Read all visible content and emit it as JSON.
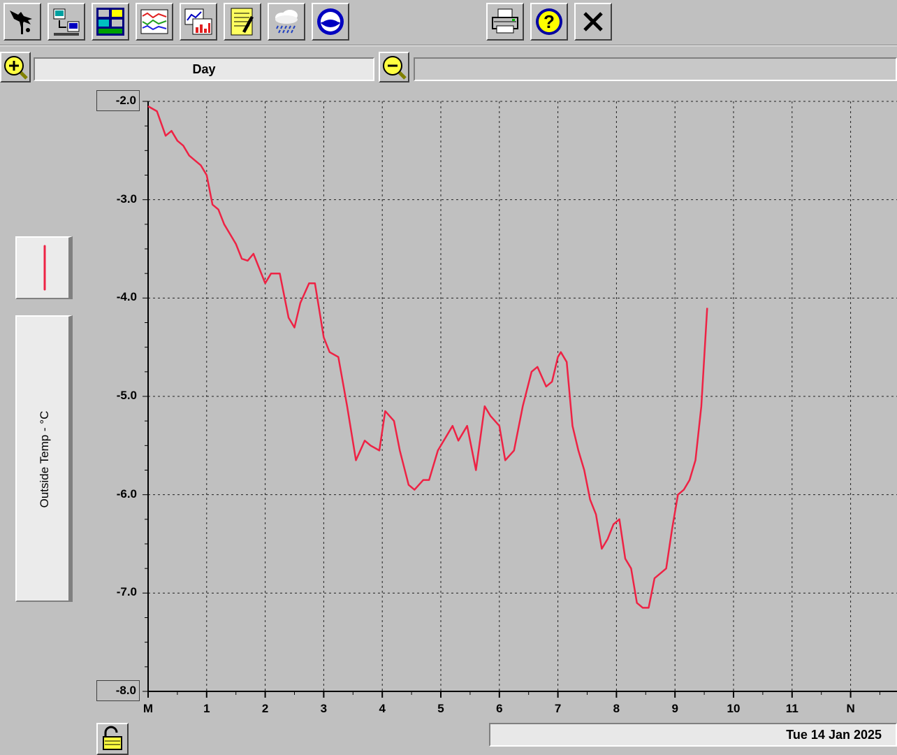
{
  "toolbar": {
    "buttons": [
      {
        "name": "weather-station-icon"
      },
      {
        "name": "download-icon"
      },
      {
        "name": "bulletin-icon"
      },
      {
        "name": "strip-chart-icon"
      },
      {
        "name": "graph-icon"
      },
      {
        "name": "notepad-icon"
      },
      {
        "name": "rain-cloud-icon"
      },
      {
        "name": "noaa-icon"
      }
    ],
    "right_buttons": [
      {
        "name": "printer-icon"
      },
      {
        "name": "help-icon"
      },
      {
        "name": "close-icon"
      }
    ]
  },
  "zoom": {
    "range_label": "Day",
    "secondary_label": ""
  },
  "legend": {
    "series_label": "Outside Temp - °C",
    "line_color": "#ee2244"
  },
  "status": {
    "date": "Tue 14 Jan 2025"
  },
  "chart_data": {
    "type": "line",
    "title": "",
    "xlabel": "",
    "ylabel": "Outside Temp - °C",
    "x_tick_labels": [
      "M",
      "1",
      "2",
      "3",
      "4",
      "5",
      "6",
      "7",
      "8",
      "9",
      "10",
      "11",
      "N"
    ],
    "y_tick_labels": [
      "-2.0",
      "-3.0",
      "-4.0",
      "-5.0",
      "-6.0",
      "-7.0",
      "-8.0"
    ],
    "xlim": [
      0,
      12
    ],
    "ylim": [
      -8.0,
      -2.0
    ],
    "grid": true,
    "series": [
      {
        "name": "Outside Temp - °C",
        "color": "#ee2244",
        "x": [
          0.0,
          0.15,
          0.3,
          0.4,
          0.5,
          0.6,
          0.7,
          0.8,
          0.9,
          1.0,
          1.1,
          1.2,
          1.3,
          1.4,
          1.5,
          1.6,
          1.7,
          1.8,
          1.9,
          2.0,
          2.1,
          2.25,
          2.4,
          2.5,
          2.6,
          2.75,
          2.85,
          3.0,
          3.1,
          3.25,
          3.4,
          3.55,
          3.7,
          3.8,
          3.95,
          4.05,
          4.2,
          4.3,
          4.45,
          4.55,
          4.7,
          4.8,
          4.95,
          5.05,
          5.2,
          5.3,
          5.45,
          5.6,
          5.75,
          5.85,
          6.0,
          6.1,
          6.25,
          6.4,
          6.55,
          6.65,
          6.8,
          6.9,
          7.0,
          7.05,
          7.15,
          7.25,
          7.35,
          7.45,
          7.55,
          7.65,
          7.75,
          7.85,
          7.95,
          8.05,
          8.15,
          8.25,
          8.35,
          8.45,
          8.55,
          8.65,
          8.75,
          8.85,
          8.95,
          9.05,
          9.15,
          9.25,
          9.35,
          9.45,
          9.55
        ],
        "y": [
          -2.05,
          -2.1,
          -2.35,
          -2.3,
          -2.4,
          -2.45,
          -2.55,
          -2.6,
          -2.65,
          -2.75,
          -3.05,
          -3.1,
          -3.25,
          -3.35,
          -3.45,
          -3.6,
          -3.62,
          -3.55,
          -3.7,
          -3.85,
          -3.75,
          -3.75,
          -4.2,
          -4.3,
          -4.05,
          -3.85,
          -3.85,
          -4.4,
          -4.55,
          -4.6,
          -5.1,
          -5.65,
          -5.45,
          -5.5,
          -5.55,
          -5.15,
          -5.25,
          -5.55,
          -5.9,
          -5.95,
          -5.85,
          -5.85,
          -5.55,
          -5.45,
          -5.3,
          -5.45,
          -5.3,
          -5.75,
          -5.1,
          -5.2,
          -5.3,
          -5.65,
          -5.55,
          -5.1,
          -4.75,
          -4.7,
          -4.9,
          -4.85,
          -4.6,
          -4.55,
          -4.65,
          -5.3,
          -5.55,
          -5.75,
          -6.05,
          -6.2,
          -6.55,
          -6.45,
          -6.3,
          -6.25,
          -6.65,
          -6.75,
          -7.1,
          -7.15,
          -7.15,
          -6.85,
          -6.8,
          -6.75,
          -6.35,
          -6.0,
          -5.95,
          -5.85,
          -5.65,
          -5.1,
          -4.1
        ]
      }
    ]
  }
}
